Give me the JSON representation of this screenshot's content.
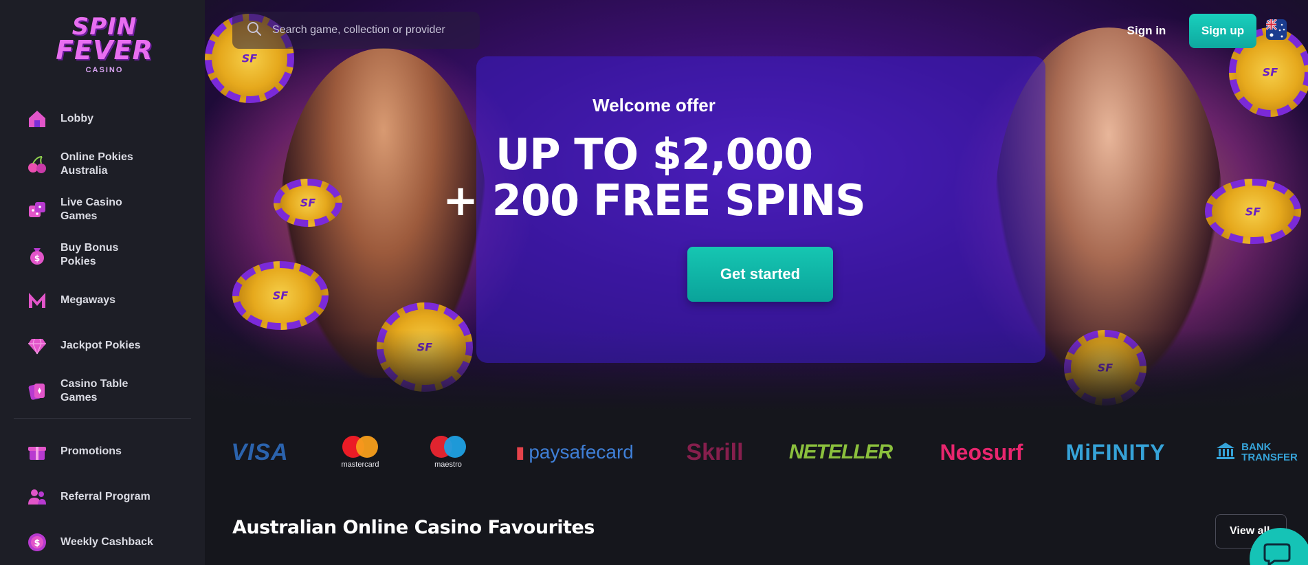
{
  "brand": {
    "line1": "SPIN",
    "line2": "FEVER",
    "sub": "CASINO"
  },
  "header": {
    "search_placeholder": "Search game, collection or provider",
    "sign_in": "Sign in",
    "sign_up": "Sign up",
    "flag_icon": "australia-flag-icon"
  },
  "sidebar": {
    "items": [
      {
        "label": "Lobby",
        "icon": "house-icon"
      },
      {
        "label": "Online Pokies Australia",
        "icon": "cherries-icon"
      },
      {
        "label": "Live Casino Games",
        "icon": "dice-icon"
      },
      {
        "label": "Buy Bonus Pokies",
        "icon": "money-bag-icon"
      },
      {
        "label": "Megaways",
        "icon": "megaways-m-icon"
      },
      {
        "label": "Jackpot Pokies",
        "icon": "diamond-icon"
      },
      {
        "label": "Casino Table Games",
        "icon": "cards-icon"
      }
    ],
    "secondary": [
      {
        "label": "Promotions",
        "icon": "gift-icon"
      },
      {
        "label": "Referral Program",
        "icon": "users-icon"
      },
      {
        "label": "Weekly Cashback",
        "icon": "dollar-coin-icon"
      }
    ]
  },
  "hero": {
    "label": "Welcome offer",
    "headline_line1": "UP TO $2,000",
    "headline_line2": "+ 200 FREE SPINS",
    "cta": "Get started"
  },
  "payments": {
    "visa": "VISA",
    "mastercard": "mastercard",
    "maestro": "maestro",
    "paysafecard": "paysafecard",
    "skrill": "Skrill",
    "neteller": "NETELLER",
    "neosurf": "Neosurf",
    "mifinity": "MiFINITY",
    "bank_line1": "BANK",
    "bank_line2": "TRANSFER"
  },
  "section": {
    "title": "Australian Online Casino Favourites",
    "view_all": "View all"
  },
  "colors": {
    "accent_teal": "#16c6b2",
    "sidebar_bg": "#1d1e26",
    "page_bg": "#15161c",
    "brand_pink": "#e86ef0"
  }
}
